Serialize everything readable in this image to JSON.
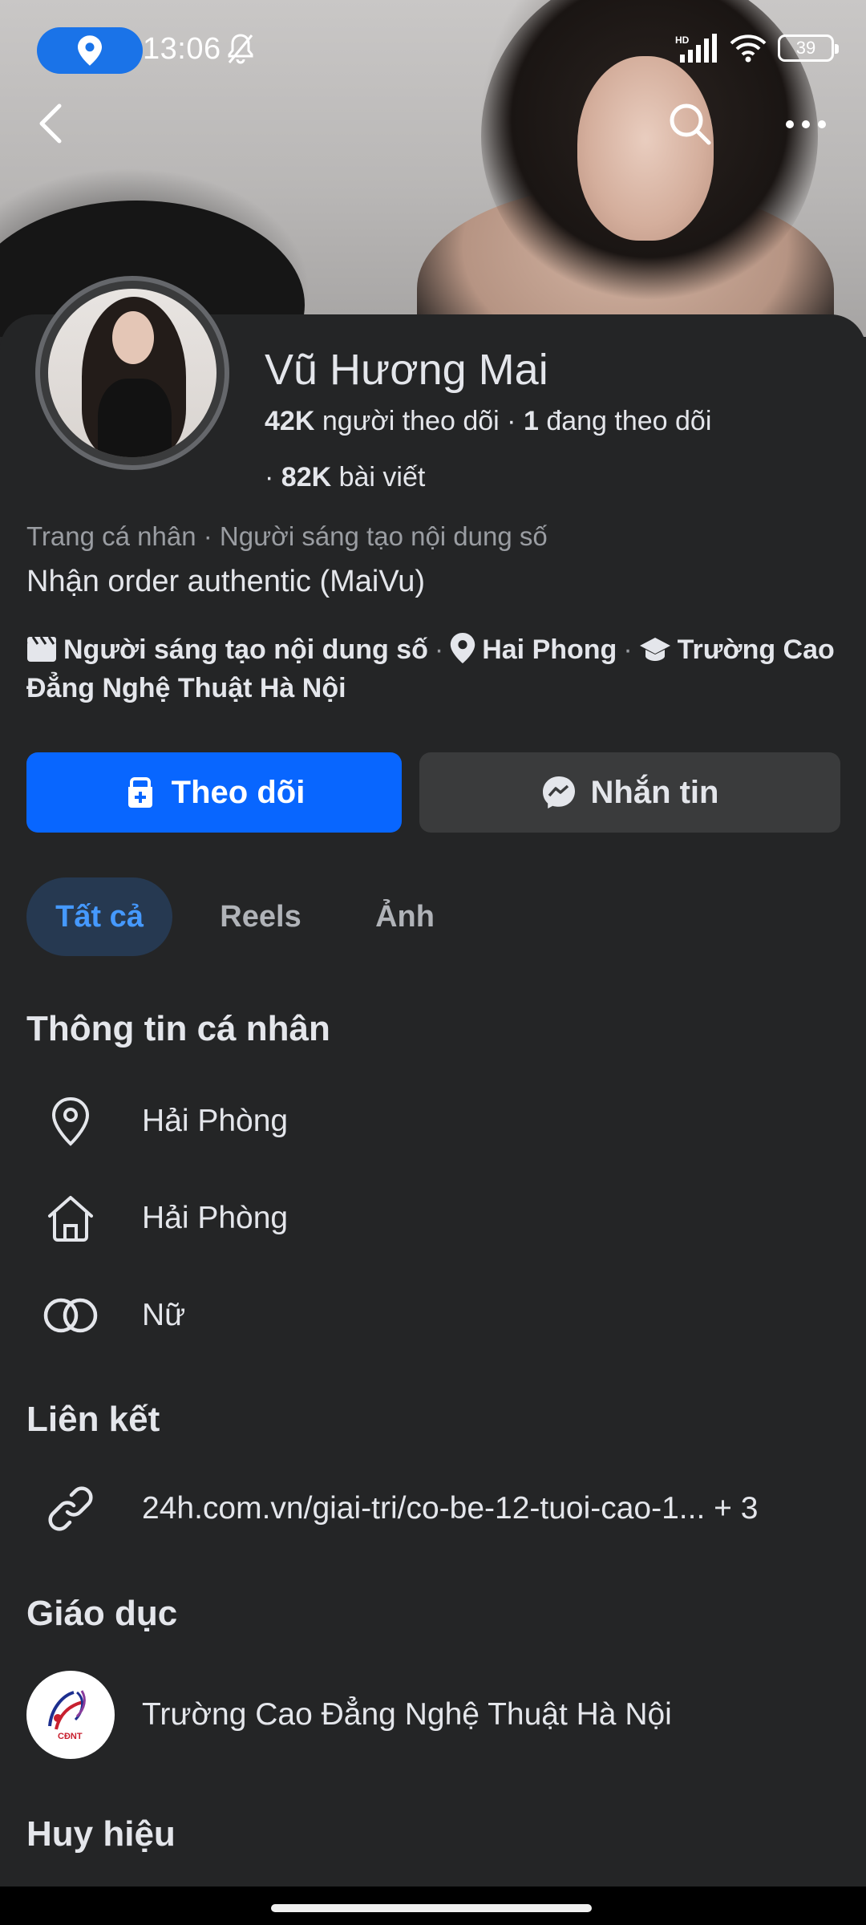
{
  "status_bar": {
    "time": "13:06",
    "battery": "39",
    "network": "HD"
  },
  "profile": {
    "name": "Vũ Hương Mai",
    "followers_count": "42K",
    "followers_label": "người theo dõi",
    "following_count": "1",
    "following_label": "đang theo dõi",
    "posts_count": "82K",
    "posts_label": "bài viết",
    "category": "Trang cá nhân · Người sáng tạo nội dung số",
    "bio": "Nhận order authentic (MaiVu)",
    "detail_creator": "Người sáng tạo nội dung số",
    "detail_location": "Hai Phong",
    "detail_school": "Trường Cao Đẳng Nghệ Thuật Hà Nội"
  },
  "buttons": {
    "follow_label": "Theo dõi",
    "message_label": "Nhắn tin"
  },
  "tabs": [
    {
      "label": "Tất cả",
      "active": true
    },
    {
      "label": "Reels",
      "active": false
    },
    {
      "label": "Ảnh",
      "active": false
    }
  ],
  "personal_info": {
    "title": "Thông tin cá nhân",
    "items": [
      {
        "icon": "location-pin-icon",
        "text": "Hải Phòng"
      },
      {
        "icon": "home-icon",
        "text": "Hải Phòng"
      },
      {
        "icon": "gender-icon",
        "text": "Nữ"
      }
    ]
  },
  "links": {
    "title": "Liên kết",
    "items": [
      {
        "icon": "link-icon",
        "text": "24h.com.vn/giai-tri/co-be-12-tuoi-cao-1... + 3"
      }
    ]
  },
  "education": {
    "title": "Giáo dục",
    "items": [
      {
        "icon": "school-logo",
        "text": "Trường Cao Đẳng Nghệ Thuật Hà Nội"
      }
    ]
  },
  "badges": {
    "title": "Huy hiệu"
  },
  "colors": {
    "background": "#242526",
    "primary_button": "#0866ff",
    "secondary_button": "#3a3b3c",
    "active_tab_bg": "#263951",
    "active_tab_text": "#4599ff"
  }
}
